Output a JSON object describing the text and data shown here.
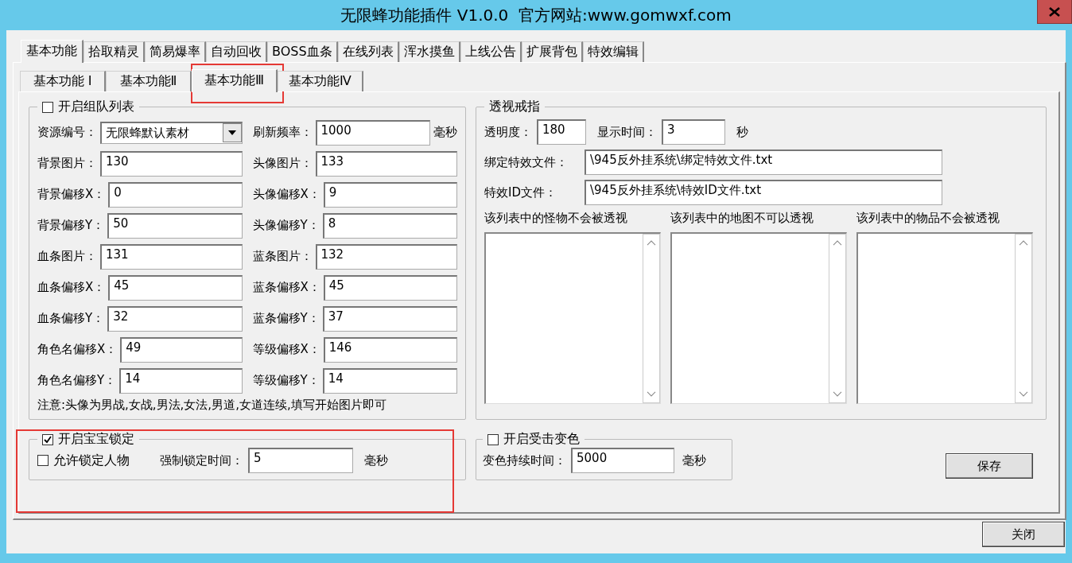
{
  "window": {
    "title": "无限蜂功能插件 V1.0.0  官方网站:www.gomwxf.com"
  },
  "tabs": [
    {
      "label": "基本功能",
      "selected": true
    },
    {
      "label": "拾取精灵",
      "selected": false
    },
    {
      "label": "简易爆率",
      "selected": false
    },
    {
      "label": "自动回收",
      "selected": false
    },
    {
      "label": "BOSS血条",
      "selected": false
    },
    {
      "label": "在线列表",
      "selected": false
    },
    {
      "label": "浑水摸鱼",
      "selected": false
    },
    {
      "label": "上线公告",
      "selected": false
    },
    {
      "label": "扩展背包",
      "selected": false
    },
    {
      "label": "特效编辑",
      "selected": false
    }
  ],
  "sub_tabs": [
    {
      "label": "基本功能 Ⅰ",
      "selected": false
    },
    {
      "label": "基本功能Ⅱ",
      "selected": false
    },
    {
      "label": "基本功能Ⅲ",
      "selected": true
    },
    {
      "label": "基本功能Ⅳ",
      "selected": false
    }
  ],
  "team_list": {
    "label": "开启组队列表",
    "checked": false,
    "rows": [
      [
        {
          "kind": "dropdown",
          "label": "资源编号：",
          "value": "无限蜂默认素材"
        },
        {
          "kind": "input",
          "label": "刷新频率：",
          "value": "1000",
          "unit": "毫秒"
        }
      ],
      [
        {
          "kind": "input",
          "label": "背景图片：",
          "value": "130"
        },
        {
          "kind": "input",
          "label": "头像图片：",
          "value": "133"
        }
      ],
      [
        {
          "kind": "input",
          "label": "背景偏移X：",
          "value": "0"
        },
        {
          "kind": "input",
          "label": "头像偏移X：",
          "value": "9"
        }
      ],
      [
        {
          "kind": "input",
          "label": "背景偏移Y：",
          "value": "50"
        },
        {
          "kind": "input",
          "label": "头像偏移Y：",
          "value": "8"
        }
      ],
      [
        {
          "kind": "input",
          "label": "血条图片：",
          "value": "131"
        },
        {
          "kind": "input",
          "label": "蓝条图片：",
          "value": "132"
        }
      ],
      [
        {
          "kind": "input",
          "label": "血条偏移X：",
          "value": "45"
        },
        {
          "kind": "input",
          "label": "蓝条偏移X：",
          "value": "45"
        }
      ],
      [
        {
          "kind": "input",
          "label": "血条偏移Y：",
          "value": "32"
        },
        {
          "kind": "input",
          "label": "蓝条偏移Y：",
          "value": "37"
        }
      ],
      [
        {
          "kind": "input",
          "label": "角色名偏移X：",
          "value": "49"
        },
        {
          "kind": "input",
          "label": "等级偏移X：",
          "value": "146"
        }
      ],
      [
        {
          "kind": "input",
          "label": "角色名偏移Y：",
          "value": "14"
        },
        {
          "kind": "input",
          "label": "等级偏移Y：",
          "value": "14"
        }
      ]
    ],
    "note": "注意:头像为男战,女战,男法,女法,男道,女道连续,填写开始图片即可"
  },
  "ring": {
    "title": "透视戒指",
    "opacity": {
      "label": "透明度：",
      "value": "180"
    },
    "display_time": {
      "label": "显示时间：",
      "value": "3",
      "unit": "秒"
    },
    "files": [
      {
        "label": "绑定特效文件：",
        "value": "\\945反外挂系统\\绑定特效文件.txt"
      },
      {
        "label": "特效ID文件：",
        "value": "\\945反外挂系统\\特效ID文件.txt"
      }
    ],
    "lists": [
      {
        "header": "该列表中的怪物不会被透视"
      },
      {
        "header": "该列表中的地图不可以透视"
      },
      {
        "header": "该列表中的物品不会被透视"
      }
    ]
  },
  "pet_lock": {
    "label": "开启宝宝锁定",
    "checked": true,
    "allow": {
      "label": "允许锁定人物",
      "checked": false
    },
    "force": {
      "label": "强制锁定时间：",
      "value": "5",
      "unit": "毫秒"
    }
  },
  "hit_color": {
    "label": "开启受击变色",
    "checked": false,
    "duration": {
      "label": "变色持续时间：",
      "value": "5000",
      "unit": "毫秒"
    }
  },
  "buttons": {
    "save": "保存",
    "close": "关闭"
  }
}
